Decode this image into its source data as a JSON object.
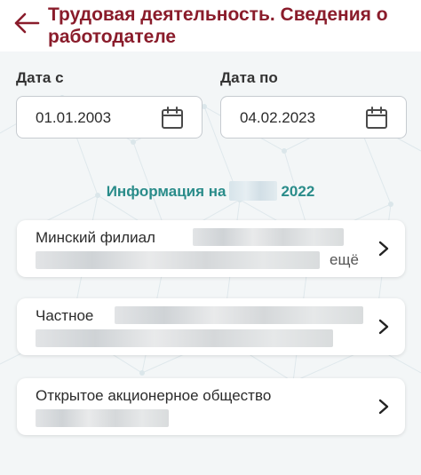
{
  "header": {
    "title": "Трудовая деятельность. Сведения о работодателе",
    "back_icon": "arrow-left-icon"
  },
  "filters": {
    "date_from": {
      "label": "Дата с",
      "value": "01.01.2003",
      "icon": "calendar-icon"
    },
    "date_to": {
      "label": "Дата по",
      "value": "04.02.2023",
      "icon": "calendar-icon"
    }
  },
  "info": {
    "prefix": "Информация на",
    "suffix": "2022"
  },
  "employers": [
    {
      "line1": "Минский филиал",
      "more": "ещё"
    },
    {
      "line1": "Частное"
    },
    {
      "line1": "Открытое акционерное общество"
    }
  ],
  "colors": {
    "title": "#8a1c2b",
    "accent": "#2a8c8a",
    "background": "#f3f6f7",
    "card": "#ffffff"
  }
}
